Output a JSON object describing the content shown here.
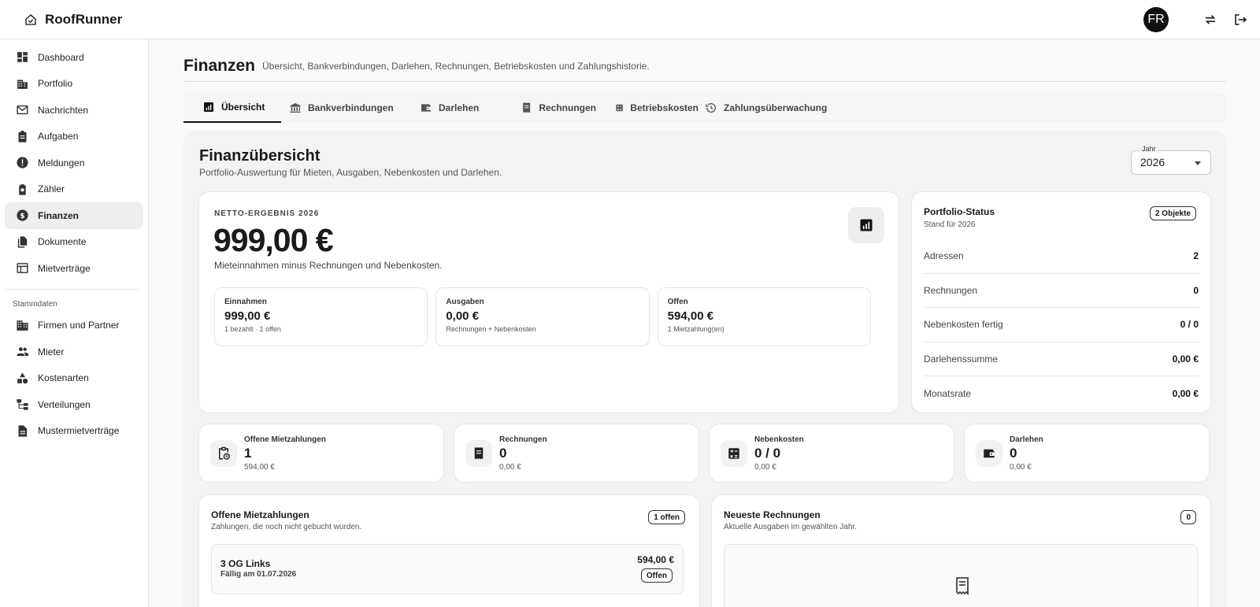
{
  "app": {
    "name": "RoofRunner",
    "avatar_initials": "FR"
  },
  "sidebar": {
    "items": [
      {
        "label": "Dashboard",
        "icon": "dashboard-icon"
      },
      {
        "label": "Portfolio",
        "icon": "building-icon"
      },
      {
        "label": "Nachrichten",
        "icon": "mail-icon"
      },
      {
        "label": "Aufgaben",
        "icon": "clipboard-icon"
      },
      {
        "label": "Meldungen",
        "icon": "alert-icon"
      },
      {
        "label": "Zähler",
        "icon": "meter-icon"
      },
      {
        "label": "Finanzen",
        "icon": "dollar-icon",
        "active": true
      },
      {
        "label": "Dokumente",
        "icon": "documents-icon"
      },
      {
        "label": "Mietverträge",
        "icon": "contract-icon"
      }
    ],
    "section_label": "Stammdaten",
    "section_items": [
      {
        "label": "Firmen und Partner",
        "icon": "company-icon"
      },
      {
        "label": "Mieter",
        "icon": "people-icon"
      },
      {
        "label": "Kostenarten",
        "icon": "shapes-icon"
      },
      {
        "label": "Verteilungen",
        "icon": "tree-icon"
      },
      {
        "label": "Mustermietverträge",
        "icon": "template-icon"
      }
    ]
  },
  "page": {
    "title": "Finanzen",
    "subtitle": "Übersicht, Bankverbindungen, Darlehen, Rechnungen, Betriebskosten und Zahlungshistorie."
  },
  "tabs": [
    {
      "label": "Übersicht",
      "active": true
    },
    {
      "label": "Bankverbindungen"
    },
    {
      "label": "Darlehen"
    },
    {
      "label": "Rechnungen"
    },
    {
      "label": "Betriebskosten"
    },
    {
      "label": "Zahlungsüberwachung"
    }
  ],
  "overview": {
    "title": "Finanzübersicht",
    "subtitle": "Portfolio-Auswertung für Mieten, Ausgaben, Nebenkosten und Darlehen.",
    "year_label": "Jahr",
    "year_value": "2026"
  },
  "netto": {
    "eyebrow": "NETTO-ERGEBNIS 2026",
    "value": "999,00 €",
    "description": "Mieteinnahmen minus Rechnungen und Nebenkosten.",
    "minis": [
      {
        "label": "Einnahmen",
        "value": "999,00 €",
        "sub": "1 bezahlt · 1 offen"
      },
      {
        "label": "Ausgaben",
        "value": "0,00 €",
        "sub": "Rechnungen + Nebenkosten"
      },
      {
        "label": "Offen",
        "value": "594,00 €",
        "sub": "1 Mietzahlung(en)"
      }
    ]
  },
  "status": {
    "title": "Portfolio-Status",
    "subtitle": "Stand für 2026",
    "badge": "2 Objekte",
    "rows": [
      {
        "label": "Adressen",
        "value": "2"
      },
      {
        "label": "Rechnungen",
        "value": "0"
      },
      {
        "label": "Nebenkosten fertig",
        "value": "0 / 0"
      },
      {
        "label": "Darlehenssumme",
        "value": "0,00 €"
      },
      {
        "label": "Monatsrate",
        "value": "0,00 €"
      }
    ]
  },
  "kpis": [
    {
      "label": "Offene Mietzahlungen",
      "value": "1",
      "sub": "594,00 €",
      "icon": "clipboard-clock-icon"
    },
    {
      "label": "Rechnungen",
      "value": "0",
      "sub": "0,00 €",
      "icon": "receipt-icon"
    },
    {
      "label": "Nebenkosten",
      "value": "0 / 0",
      "sub": "0,00 €",
      "icon": "calculator-icon"
    },
    {
      "label": "Darlehen",
      "value": "0",
      "sub": "0,00 €",
      "icon": "wallet-icon"
    }
  ],
  "open_payments": {
    "title": "Offene Mietzahlungen",
    "subtitle": "Zahlungen, die noch nicht gebucht wurden.",
    "badge": "1 offen",
    "items": [
      {
        "name": "3 OG Links",
        "due": "Fällig am 01.07.2026",
        "amount": "594,00 €",
        "status": "Offen"
      }
    ]
  },
  "newest_invoices": {
    "title": "Neueste Rechnungen",
    "subtitle": "Aktuelle Ausgaben im gewählten Jahr.",
    "badge": "0"
  }
}
